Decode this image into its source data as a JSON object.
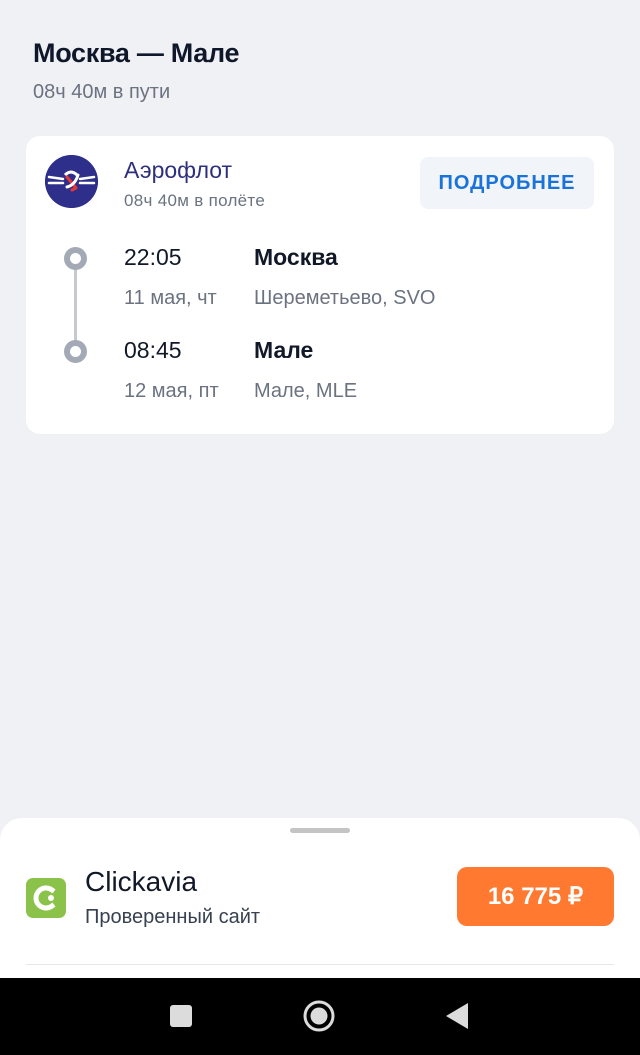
{
  "header": {
    "title": "Москва — Мале",
    "duration": "08ч 40м в пути"
  },
  "flight": {
    "airline": "Аэрофлот",
    "flight_time": "08ч 40м в полёте",
    "details_button": "ПОДРОБНЕЕ",
    "departure": {
      "time": "22:05",
      "date": "11 мая, чт",
      "city": "Москва",
      "airport": "Шереметьево, SVO"
    },
    "arrival": {
      "time": "08:45",
      "date": "12 мая, пт",
      "city": "Мале",
      "airport": "Мале, MLE"
    }
  },
  "offer": {
    "agency": "Clickavia",
    "subtitle": "Проверенный сайт",
    "price": "16 775 ₽"
  },
  "nav": {
    "icons": [
      "recent-apps-icon",
      "home-icon",
      "back-icon"
    ]
  },
  "colors": {
    "background": "#f0f1f5",
    "airline_brand": "#2d2f8a",
    "details_text": "#1a73d9",
    "price_button": "#ff7a30",
    "agency_logo": "#8bc34a"
  }
}
